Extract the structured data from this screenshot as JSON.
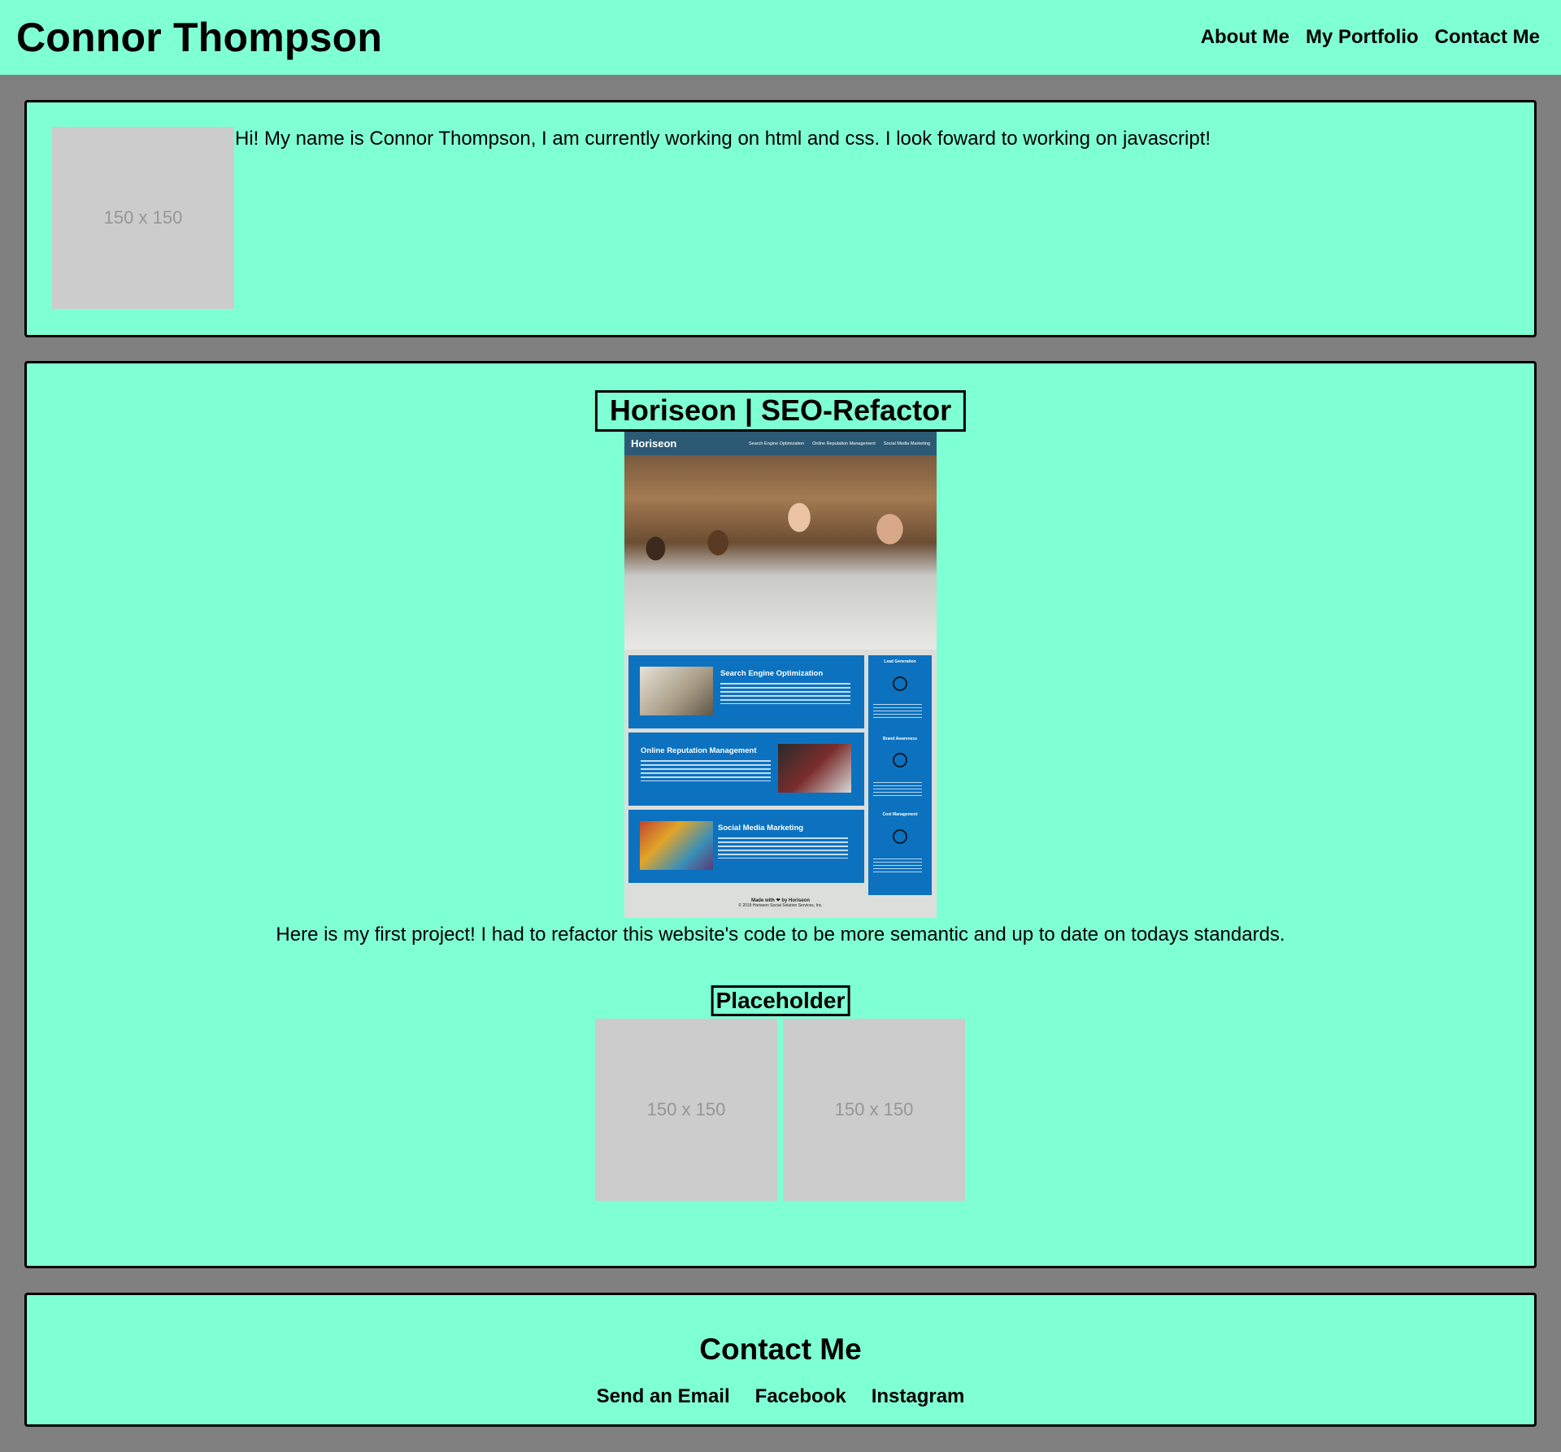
{
  "header": {
    "title": "Connor Thompson",
    "nav": [
      "About Me",
      "My Portfolio",
      "Contact Me"
    ]
  },
  "about": {
    "image_placeholder": "150 x 150",
    "text": "Hi! My name is Connor Thompson, I am currently working on html and css. I look foward to working on javascript!"
  },
  "portfolio": {
    "project_title": "Horiseon | SEO-Refactor",
    "screenshot": {
      "logo": "Horiseon",
      "nav": [
        "Search Engine Optimization",
        "Online Reputation Management",
        "Social Media Marketing"
      ],
      "cards": [
        "Search Engine Optimization",
        "Online Reputation Management",
        "Social Media Marketing"
      ],
      "sidebar": [
        "Lead Generation",
        "Brand Awareness",
        "Cost Management"
      ],
      "footer": "Made with ❤ by Horiseon",
      "copyright": "© 2019 Horiseon Social Solution Services, Inc."
    },
    "project_description": "Here is my first project! I had to refactor this website's code to be more semantic and up to date on todays standards.",
    "placeholder_title": "Placeholder",
    "placeholder_images": [
      "150 x 150",
      "150 x 150"
    ]
  },
  "contact": {
    "title": "Contact Me",
    "links": [
      "Send an Email",
      "Facebook",
      "Instagram"
    ]
  },
  "colors": {
    "page_background": "#808080",
    "panel_background": "#7fffd4",
    "placeholder_gray": "#cccccc",
    "horiseon_blue": "#0c72bf"
  }
}
